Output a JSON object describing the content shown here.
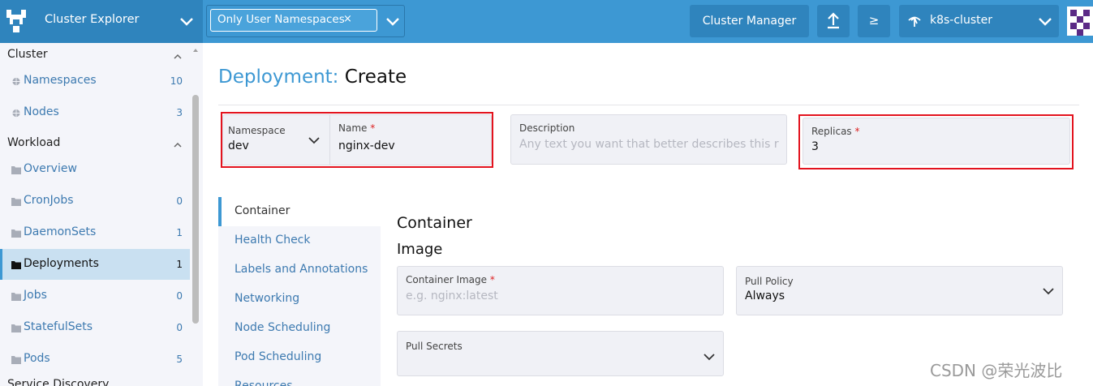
{
  "header": {
    "app_title": "Cluster Explorer",
    "namespace_filter": {
      "chip_label": "Only User Namespaces",
      "chip_remove": "×"
    },
    "cluster_manager_label": "Cluster Manager",
    "shell_label": "≥",
    "cluster_selector": {
      "value": "k8s-cluster"
    },
    "accent_color": "#3d98d3"
  },
  "sidebar": {
    "groups": [
      {
        "label": "Cluster",
        "items": [
          {
            "label": "Namespaces",
            "count": "10",
            "icon": "globe-icon"
          },
          {
            "label": "Nodes",
            "count": "3",
            "icon": "globe-icon"
          }
        ]
      },
      {
        "label": "Workload",
        "items": [
          {
            "label": "Overview",
            "count": "",
            "icon": "folder-icon"
          },
          {
            "label": "CronJobs",
            "count": "0",
            "icon": "folder-icon"
          },
          {
            "label": "DaemonSets",
            "count": "1",
            "icon": "folder-icon"
          },
          {
            "label": "Deployments",
            "count": "1",
            "icon": "folder-icon",
            "active": true
          },
          {
            "label": "Jobs",
            "count": "0",
            "icon": "folder-icon"
          },
          {
            "label": "StatefulSets",
            "count": "0",
            "icon": "folder-icon"
          },
          {
            "label": "Pods",
            "count": "5",
            "icon": "folder-icon"
          }
        ]
      }
    ],
    "next_group_partial": "Service Discovery"
  },
  "main": {
    "title_prefix": "Deployment:",
    "title_action": "Create",
    "namespace_field": {
      "label": "Namespace",
      "value": "dev"
    },
    "name_field": {
      "label": "Name",
      "required": "*",
      "value": "nginx-dev"
    },
    "description_field": {
      "label": "Description",
      "placeholder": "Any text you want that better describes this resource"
    },
    "replicas_field": {
      "label": "Replicas",
      "required": "*",
      "value": "3"
    },
    "tabs": [
      {
        "label": "Container",
        "active": true
      },
      {
        "label": "Health Check"
      },
      {
        "label": "Labels and Annotations"
      },
      {
        "label": "Networking"
      },
      {
        "label": "Node Scheduling"
      },
      {
        "label": "Pod Scheduling"
      },
      {
        "label": "Resources"
      }
    ],
    "container_heading": "Container",
    "image_heading": "Image",
    "container_image_field": {
      "label": "Container Image",
      "required": "*",
      "placeholder": "e.g. nginx:latest"
    },
    "pull_policy_field": {
      "label": "Pull Policy",
      "value": "Always"
    },
    "pull_secrets_field": {
      "label": "Pull Secrets"
    }
  },
  "watermark": "CSDN @荣光波比",
  "highlight_color": "#e3131e"
}
